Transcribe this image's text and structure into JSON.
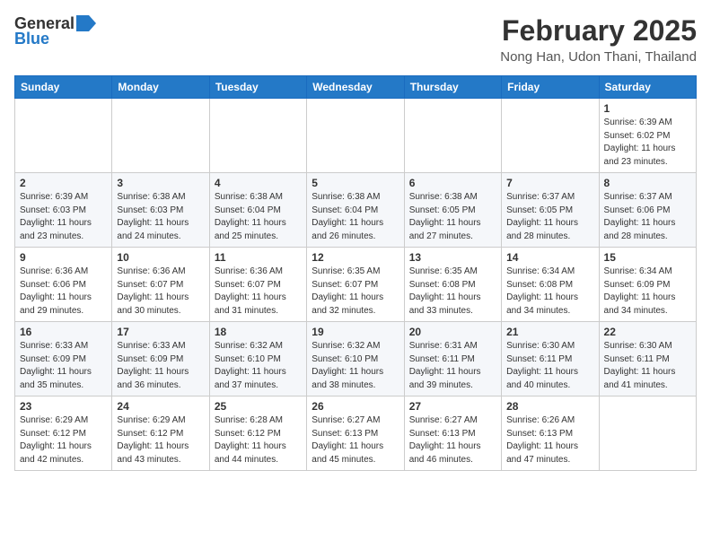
{
  "header": {
    "logo_general": "General",
    "logo_blue": "Blue",
    "month": "February 2025",
    "location": "Nong Han, Udon Thani, Thailand"
  },
  "weekdays": [
    "Sunday",
    "Monday",
    "Tuesday",
    "Wednesday",
    "Thursday",
    "Friday",
    "Saturday"
  ],
  "weeks": [
    [
      {
        "day": "",
        "info": ""
      },
      {
        "day": "",
        "info": ""
      },
      {
        "day": "",
        "info": ""
      },
      {
        "day": "",
        "info": ""
      },
      {
        "day": "",
        "info": ""
      },
      {
        "day": "",
        "info": ""
      },
      {
        "day": "1",
        "info": "Sunrise: 6:39 AM\nSunset: 6:02 PM\nDaylight: 11 hours\nand 23 minutes."
      }
    ],
    [
      {
        "day": "2",
        "info": "Sunrise: 6:39 AM\nSunset: 6:03 PM\nDaylight: 11 hours\nand 23 minutes."
      },
      {
        "day": "3",
        "info": "Sunrise: 6:38 AM\nSunset: 6:03 PM\nDaylight: 11 hours\nand 24 minutes."
      },
      {
        "day": "4",
        "info": "Sunrise: 6:38 AM\nSunset: 6:04 PM\nDaylight: 11 hours\nand 25 minutes."
      },
      {
        "day": "5",
        "info": "Sunrise: 6:38 AM\nSunset: 6:04 PM\nDaylight: 11 hours\nand 26 minutes."
      },
      {
        "day": "6",
        "info": "Sunrise: 6:38 AM\nSunset: 6:05 PM\nDaylight: 11 hours\nand 27 minutes."
      },
      {
        "day": "7",
        "info": "Sunrise: 6:37 AM\nSunset: 6:05 PM\nDaylight: 11 hours\nand 28 minutes."
      },
      {
        "day": "8",
        "info": "Sunrise: 6:37 AM\nSunset: 6:06 PM\nDaylight: 11 hours\nand 28 minutes."
      }
    ],
    [
      {
        "day": "9",
        "info": "Sunrise: 6:36 AM\nSunset: 6:06 PM\nDaylight: 11 hours\nand 29 minutes."
      },
      {
        "day": "10",
        "info": "Sunrise: 6:36 AM\nSunset: 6:07 PM\nDaylight: 11 hours\nand 30 minutes."
      },
      {
        "day": "11",
        "info": "Sunrise: 6:36 AM\nSunset: 6:07 PM\nDaylight: 11 hours\nand 31 minutes."
      },
      {
        "day": "12",
        "info": "Sunrise: 6:35 AM\nSunset: 6:07 PM\nDaylight: 11 hours\nand 32 minutes."
      },
      {
        "day": "13",
        "info": "Sunrise: 6:35 AM\nSunset: 6:08 PM\nDaylight: 11 hours\nand 33 minutes."
      },
      {
        "day": "14",
        "info": "Sunrise: 6:34 AM\nSunset: 6:08 PM\nDaylight: 11 hours\nand 34 minutes."
      },
      {
        "day": "15",
        "info": "Sunrise: 6:34 AM\nSunset: 6:09 PM\nDaylight: 11 hours\nand 34 minutes."
      }
    ],
    [
      {
        "day": "16",
        "info": "Sunrise: 6:33 AM\nSunset: 6:09 PM\nDaylight: 11 hours\nand 35 minutes."
      },
      {
        "day": "17",
        "info": "Sunrise: 6:33 AM\nSunset: 6:09 PM\nDaylight: 11 hours\nand 36 minutes."
      },
      {
        "day": "18",
        "info": "Sunrise: 6:32 AM\nSunset: 6:10 PM\nDaylight: 11 hours\nand 37 minutes."
      },
      {
        "day": "19",
        "info": "Sunrise: 6:32 AM\nSunset: 6:10 PM\nDaylight: 11 hours\nand 38 minutes."
      },
      {
        "day": "20",
        "info": "Sunrise: 6:31 AM\nSunset: 6:11 PM\nDaylight: 11 hours\nand 39 minutes."
      },
      {
        "day": "21",
        "info": "Sunrise: 6:30 AM\nSunset: 6:11 PM\nDaylight: 11 hours\nand 40 minutes."
      },
      {
        "day": "22",
        "info": "Sunrise: 6:30 AM\nSunset: 6:11 PM\nDaylight: 11 hours\nand 41 minutes."
      }
    ],
    [
      {
        "day": "23",
        "info": "Sunrise: 6:29 AM\nSunset: 6:12 PM\nDaylight: 11 hours\nand 42 minutes."
      },
      {
        "day": "24",
        "info": "Sunrise: 6:29 AM\nSunset: 6:12 PM\nDaylight: 11 hours\nand 43 minutes."
      },
      {
        "day": "25",
        "info": "Sunrise: 6:28 AM\nSunset: 6:12 PM\nDaylight: 11 hours\nand 44 minutes."
      },
      {
        "day": "26",
        "info": "Sunrise: 6:27 AM\nSunset: 6:13 PM\nDaylight: 11 hours\nand 45 minutes."
      },
      {
        "day": "27",
        "info": "Sunrise: 6:27 AM\nSunset: 6:13 PM\nDaylight: 11 hours\nand 46 minutes."
      },
      {
        "day": "28",
        "info": "Sunrise: 6:26 AM\nSunset: 6:13 PM\nDaylight: 11 hours\nand 47 minutes."
      },
      {
        "day": "",
        "info": ""
      }
    ]
  ]
}
